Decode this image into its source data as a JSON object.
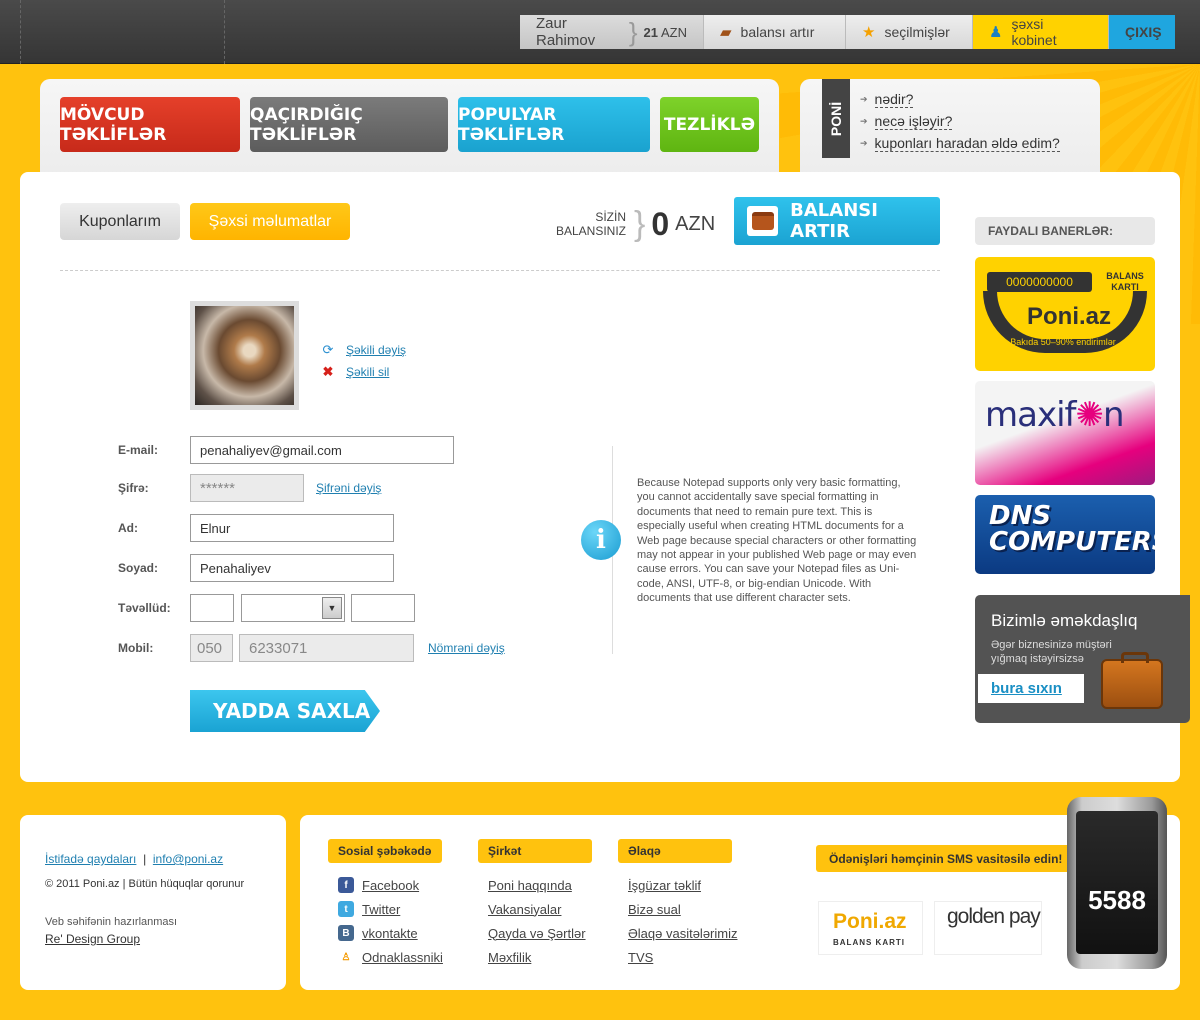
{
  "topnav": {
    "user_name": "Zaur Rahimov",
    "balance_amount": "21",
    "balance_currency": "AZN",
    "topup_label": "balansı artır",
    "favorites_label": "seçilmişlər",
    "cabinet_label": "şəxsi kobinet",
    "exit_label": "ÇIXIŞ"
  },
  "main_tabs": [
    {
      "label": "MÖVCUD TƏKLİFLƏR",
      "color": "#d9321f"
    },
    {
      "label": "QAÇIRDIĞIÇ TƏKLİFLƏR",
      "color": "#6b6b6b"
    },
    {
      "label": "POPULYAR TƏKLİFLƏR",
      "color": "#22b0de"
    },
    {
      "label": "TEZLİKLƏ",
      "color": "#6dc41c"
    }
  ],
  "help": {
    "tag": "PONİ",
    "links": [
      "nədir?",
      "necə işləyir?",
      "kuponları haradan əldə edim?"
    ]
  },
  "account_tabs": {
    "coupons_label": "Kuponlarım",
    "personal_label": "Şəxsi məlumatlar"
  },
  "balance": {
    "label": "SİZİN BALANSINIZ",
    "amount": "0",
    "currency": "AZN",
    "topup_button": "BALANSI ARTIR"
  },
  "photo": {
    "change_label": "Şəkili dəyiş",
    "delete_label": "Şəkili sil"
  },
  "form": {
    "email_label": "E-mail:",
    "email_value": "penahaliyev@gmail.com",
    "password_label": "Şifrə:",
    "password_value": "******",
    "password_change": "Şifrəni dəyiş",
    "name_label": "Ad:",
    "name_value": "Elnur",
    "surname_label": "Soyad:",
    "surname_value": "Penahaliyev",
    "birth_label": "Təvəllüd:",
    "mobile_label": "Mobil:",
    "mobile_prefix": "050",
    "mobile_number": "6233071",
    "mobile_change": "Nömrəni dəyiş",
    "save_button": "YADDA SAXLA"
  },
  "info_text": "Because Notepad supports only very basic formatting, you cannot accidentally save special formatting in documents that need to remain pure text. This is especially useful when creating HTML documents for a Web page because special characters or other formatting may not appear in your published Web page or may even cause errors. You can save your Notepad files as Uni-code, ANSI, UTF-8, or big-endian Unicode. With documents that use different character sets.",
  "banners": {
    "heading": "FAYDALI BANERLƏR:",
    "poni_code": "0000000000",
    "poni_card_label": "BALANS KARTI",
    "poni_logo": "Poni.az",
    "poni_sub": "Bakıda 50–90% endirimlər",
    "maxifon_logo_a": "maxif",
    "maxifon_logo_b": "✺",
    "maxifon_logo_c": "n",
    "dns_line1": "DNS",
    "dns_line2": "COMPUTERS"
  },
  "coop": {
    "title": "Bizimlə əməkdaşlıq",
    "text": "Əgər biznesinizə müştəri yığmaq istəyirsizsə",
    "button": "bura sıxın"
  },
  "footer": {
    "rules": "İstifadə qaydaları",
    "email": "info@poni.az",
    "copyright": "© 2011 Poni.az  |  Bütün hüquqlar qorunur",
    "made_by_label": "Veb səhifənin hazırlanması",
    "made_by": "Re' Design Group",
    "social_head": "Sosial şəbəkədə",
    "social": [
      "Facebook",
      "Twitter",
      "vkontakte",
      "Odnaklassniki"
    ],
    "company_head": "Şirkət",
    "company": [
      "Poni haqqında",
      "Vakansiyalar",
      "Qayda və Şərtlər",
      "Məxfilik"
    ],
    "contact_head": "Əlaqə",
    "contact": [
      "İşgüzar təklif",
      "Bizə sual",
      "Əlaqə vasitələrimiz",
      "TVS"
    ],
    "sms_text": "Ödənişləri həmçinin SMS vasitəsilə edin!",
    "poni_card_logo": "Poni.az",
    "poni_card_sub": "BALANS KARTI",
    "goldenpay_logo": "golden pay",
    "sms_number": "5588"
  }
}
